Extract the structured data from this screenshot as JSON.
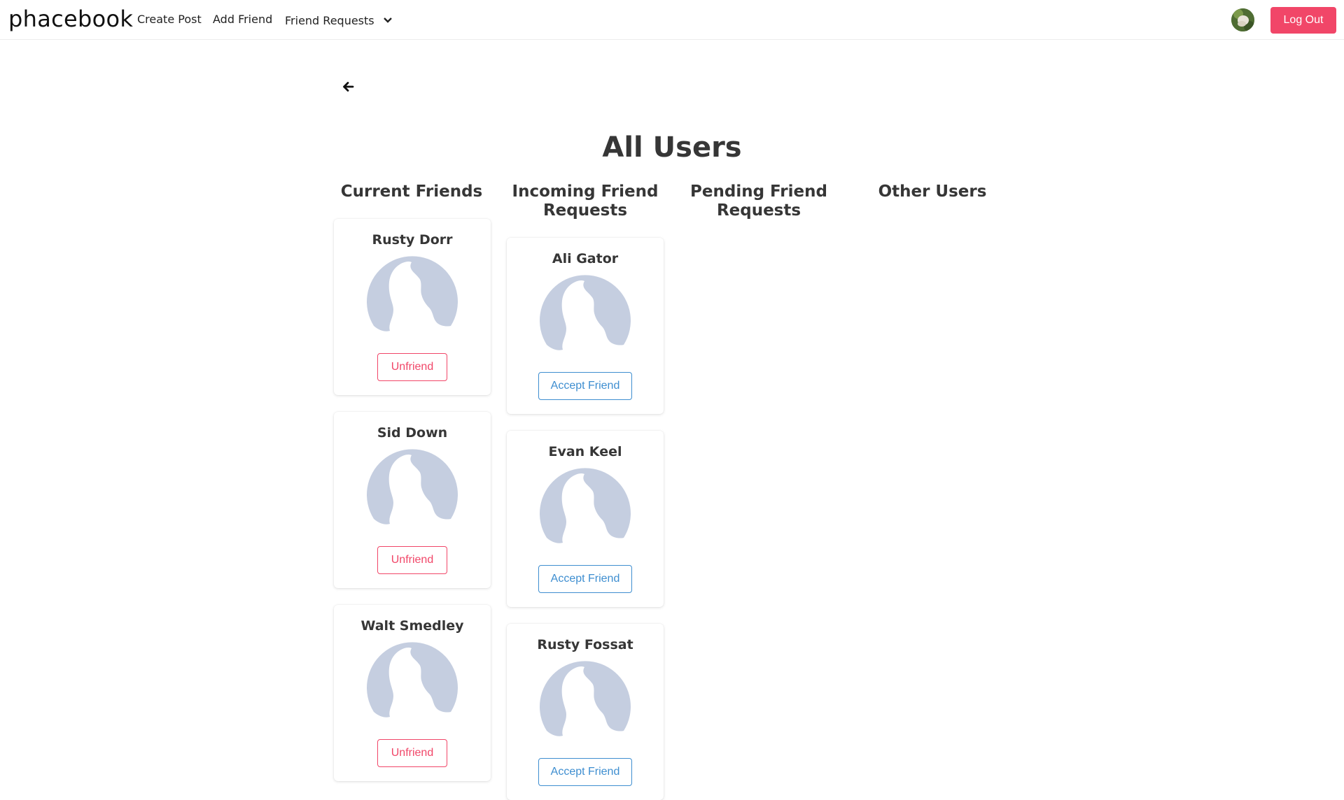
{
  "navbar": {
    "brand": "phacebook",
    "links": {
      "create_post": "Create Post",
      "add_friend": "Add Friend",
      "friend_requests": "Friend Requests"
    },
    "logout_label": "Log Out"
  },
  "page": {
    "title": "All Users",
    "columns": {
      "current_friends": "Current Friends",
      "incoming": "Incoming Friend Requests",
      "pending": "Pending Friend Requests",
      "other": "Other Users"
    }
  },
  "current_friends": [
    {
      "name": "Rusty Dorr",
      "action": "Unfriend"
    },
    {
      "name": "Sid Down",
      "action": "Unfriend"
    },
    {
      "name": "Walt Smedley",
      "action": "Unfriend"
    }
  ],
  "incoming_requests": [
    {
      "name": "Ali Gator",
      "action": "Accept Friend"
    },
    {
      "name": "Evan Keel",
      "action": "Accept Friend"
    },
    {
      "name": "Rusty Fossat",
      "action": "Accept Friend"
    }
  ],
  "colors": {
    "danger": "#f14668",
    "info": "#3e8ed0",
    "silhouette": "#c5cee0"
  },
  "icons": {
    "back": "arrow-left-icon",
    "chevron": "chevron-down-icon",
    "avatar": "default-user-silhouette"
  }
}
